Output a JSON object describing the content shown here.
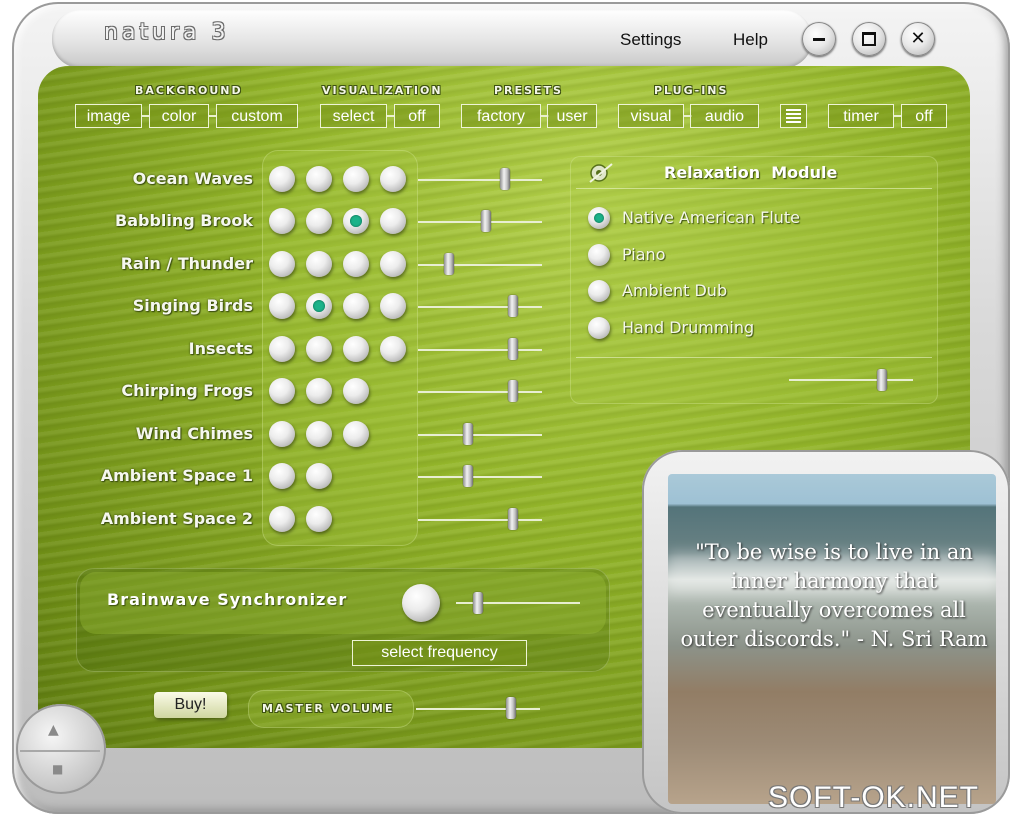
{
  "app": {
    "title": "natura 3"
  },
  "menu": {
    "settings": "Settings",
    "help": "Help"
  },
  "window_controls": {
    "minimize": "−",
    "maximize": "□",
    "close": "✕"
  },
  "toolbar": {
    "background": {
      "label": "BACKGROUND",
      "buttons": [
        "image",
        "color",
        "custom"
      ]
    },
    "visualization": {
      "label": "VISUALIZATION",
      "buttons": [
        "select",
        "off"
      ]
    },
    "presets": {
      "label": "PRESETS",
      "buttons": [
        "factory",
        "user"
      ]
    },
    "plugins": {
      "label": "PLUG-INS",
      "buttons": [
        "visual",
        "audio"
      ]
    },
    "timer": {
      "label": "timer",
      "state": "off"
    }
  },
  "sounds": [
    {
      "name": "Ocean Waves",
      "variants": 4,
      "selected": -1,
      "volume": 0.7
    },
    {
      "name": "Babbling Brook",
      "variants": 4,
      "selected": 2,
      "volume": 0.55
    },
    {
      "name": "Rain / Thunder",
      "variants": 4,
      "selected": -1,
      "volume": 0.25
    },
    {
      "name": "Singing Birds",
      "variants": 4,
      "selected": 1,
      "volume": 0.77
    },
    {
      "name": "Insects",
      "variants": 4,
      "selected": -1,
      "volume": 0.77
    },
    {
      "name": "Chirping Frogs",
      "variants": 3,
      "selected": -1,
      "volume": 0.77
    },
    {
      "name": "Wind Chimes",
      "variants": 3,
      "selected": -1,
      "volume": 0.4
    },
    {
      "name": "Ambient Space 1",
      "variants": 2,
      "selected": -1,
      "volume": 0.4
    },
    {
      "name": "Ambient Space 2",
      "variants": 2,
      "selected": -1,
      "volume": 0.77
    }
  ],
  "relaxation": {
    "title": "Relaxation  Module",
    "options": [
      "Native American Flute",
      "Piano",
      "Ambient Dub",
      "Hand Drumming"
    ],
    "selected": 0,
    "volume": 0.75
  },
  "brainwave": {
    "title": "Brainwave Synchronizer",
    "button": "select frequency",
    "level": 0.18
  },
  "buy": "Buy!",
  "master": {
    "label": "MASTER VOLUME",
    "volume": 0.77
  },
  "quote": "\"To be wise is to live in an inner harmony that eventually overcomes all outer discords.\" - N. Sri Ram",
  "scroll": {
    "up": "▲",
    "stop": "■"
  },
  "watermark": "SOFT-OK.NET",
  "colors": {
    "panel_green": "#94b62a",
    "selected_dot": "#1cb38a"
  }
}
